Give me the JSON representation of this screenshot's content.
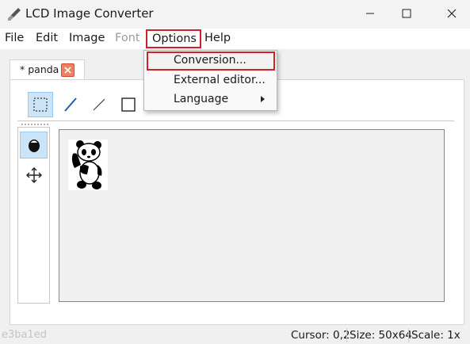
{
  "window": {
    "title": "LCD Image Converter",
    "icons": {
      "app": "brush-icon",
      "minimize": "minimize-icon",
      "maximize": "maximize-icon",
      "close": "close-icon"
    }
  },
  "menubar": {
    "file": "File",
    "edit": "Edit",
    "image": "Image",
    "font": "Font",
    "options": "Options",
    "help": "Help"
  },
  "options_menu": {
    "conversion": "Conversion...",
    "external_editor": "External editor...",
    "language": "Language"
  },
  "tab": {
    "label": "* panda"
  },
  "toolbar": {
    "tools": [
      "select-rect-icon",
      "pen-icon",
      "line-icon",
      "rectangle-icon"
    ]
  },
  "side_tools": [
    "fill-icon",
    "move-icon"
  ],
  "status": {
    "faint": "e3ba1ed",
    "cursor": "Cursor: 0,2",
    "size": "Size: 50x64",
    "scale": "Scale: 1x"
  },
  "colors": {
    "highlight_red": "#d0202a",
    "selected_tool": "#cce4f7"
  }
}
